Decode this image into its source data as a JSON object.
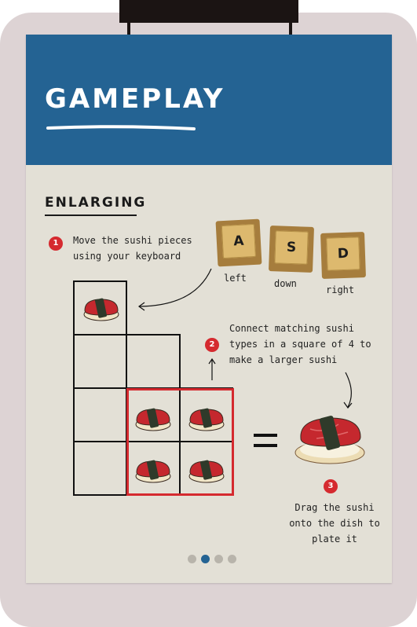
{
  "header": {
    "title": "GAMEPLAY"
  },
  "section": {
    "title": "ENLARGING"
  },
  "steps": [
    {
      "number": "1",
      "lines": [
        "Move the sushi pieces",
        "using your keyboard"
      ]
    },
    {
      "number": "2",
      "lines": [
        "Connect matching sushi",
        "types in a square of 4 to",
        "make a larger sushi"
      ]
    },
    {
      "number": "3",
      "lines": [
        "Drag the sushi",
        "onto the dish to",
        "plate it"
      ]
    }
  ],
  "keys": [
    {
      "key": "A",
      "label": "left"
    },
    {
      "key": "S",
      "label": "down"
    },
    {
      "key": "D",
      "label": "right"
    }
  ],
  "pagination": {
    "total": 4,
    "active_index": 1
  },
  "colors": {
    "header_bg": "#246393",
    "card_bg": "#e3e0d6",
    "accent_red": "#d52a2f",
    "board_bg": "#ddd3d4"
  }
}
